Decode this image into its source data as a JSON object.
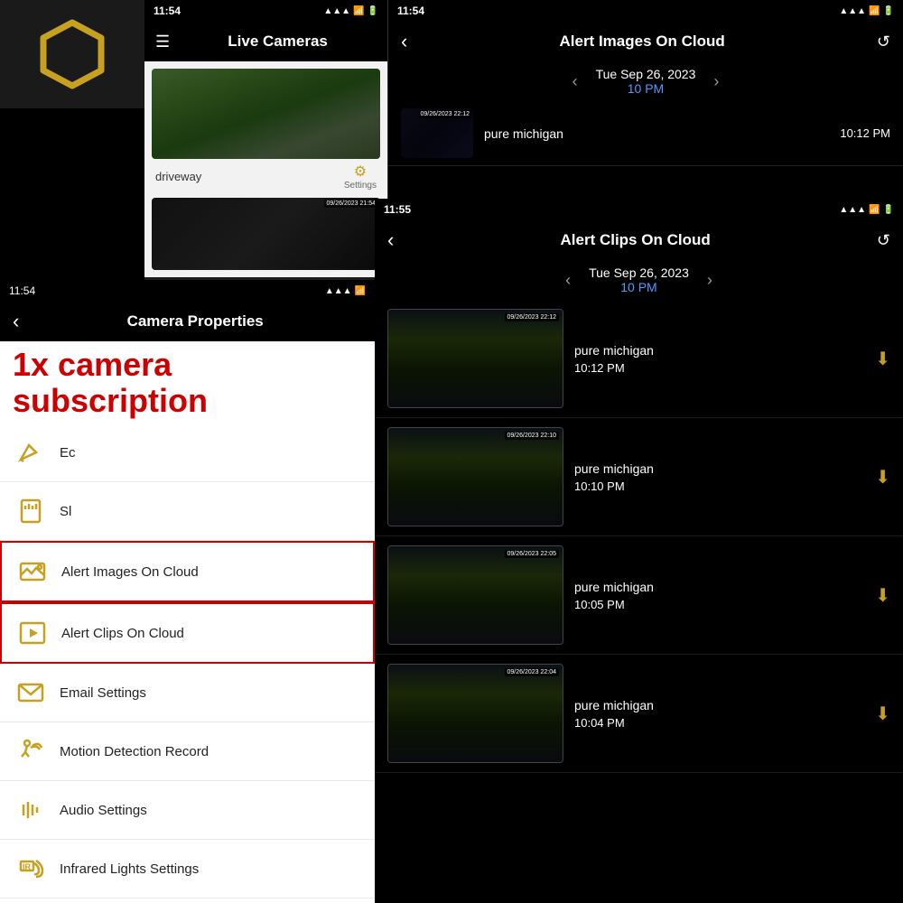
{
  "logo": {
    "alt": "App Logo"
  },
  "panel_live_cameras": {
    "status_bar": {
      "time": "11:54",
      "signal": "▲▲▲",
      "wifi": "wifi",
      "battery": ""
    },
    "nav": {
      "menu_icon": "☰",
      "title": "Live Cameras"
    },
    "camera": {
      "name": "driveway",
      "settings_label": "Settings"
    }
  },
  "panel_alert_images": {
    "status_bar": {
      "time": "11:54",
      "signal": "▲▲▲",
      "wifi": "wifi",
      "battery": ""
    },
    "nav": {
      "back_icon": "‹",
      "title": "Alert Images On Cloud",
      "refresh_icon": "↺"
    },
    "date": "Tue Sep 26, 2023",
    "time_filter": "10 PM",
    "alert_item": {
      "name": "pure michigan",
      "time": "10:12 PM",
      "timestamp": "09/26/2023 22:12"
    }
  },
  "panel_camera_props": {
    "status_bar": {
      "time": "11:54",
      "signal": "▲▲▲",
      "wifi": "wifi"
    },
    "nav": {
      "back_icon": "‹",
      "title": "Camera Properties"
    },
    "subscription_text": "1x camera subscription",
    "menu_items": [
      {
        "id": "edit",
        "label": "Ec",
        "icon": "edit"
      },
      {
        "id": "sd",
        "label": "Sl",
        "icon": "sd-card"
      },
      {
        "id": "alert-images",
        "label": "Alert Images On Cloud",
        "icon": "image",
        "highlighted": true
      },
      {
        "id": "alert-clips",
        "label": "Alert Clips On Cloud",
        "icon": "play",
        "highlighted": true
      },
      {
        "id": "email",
        "label": "Email Settings",
        "icon": "email"
      },
      {
        "id": "motion",
        "label": "Motion Detection Record",
        "icon": "motion"
      },
      {
        "id": "audio",
        "label": "Audio Settings",
        "icon": "audio"
      },
      {
        "id": "infrared",
        "label": "Infrared Lights Settings",
        "icon": "infrared"
      }
    ]
  },
  "panel_alert_clips": {
    "status_bar": {
      "time": "11:55",
      "signal": "▲▲▲",
      "wifi": "wifi",
      "battery": ""
    },
    "nav": {
      "back_icon": "‹",
      "title": "Alert Clips On Cloud",
      "refresh_icon": "↺"
    },
    "date": "Tue Sep 26, 2023",
    "time_filter": "10 PM",
    "clips": [
      {
        "name": "pure michigan",
        "time": "10:12 PM",
        "timestamp": "09/26/2023 22:12"
      },
      {
        "name": "pure michigan",
        "time": "10:10 PM",
        "timestamp": "09/26/2023 22:10"
      },
      {
        "name": "pure michigan",
        "time": "10:05 PM",
        "timestamp": "09/26/2023 22:05"
      },
      {
        "name": "pure michigan",
        "time": "10:04 PM",
        "timestamp": "09/26/2023 22:04"
      }
    ]
  }
}
